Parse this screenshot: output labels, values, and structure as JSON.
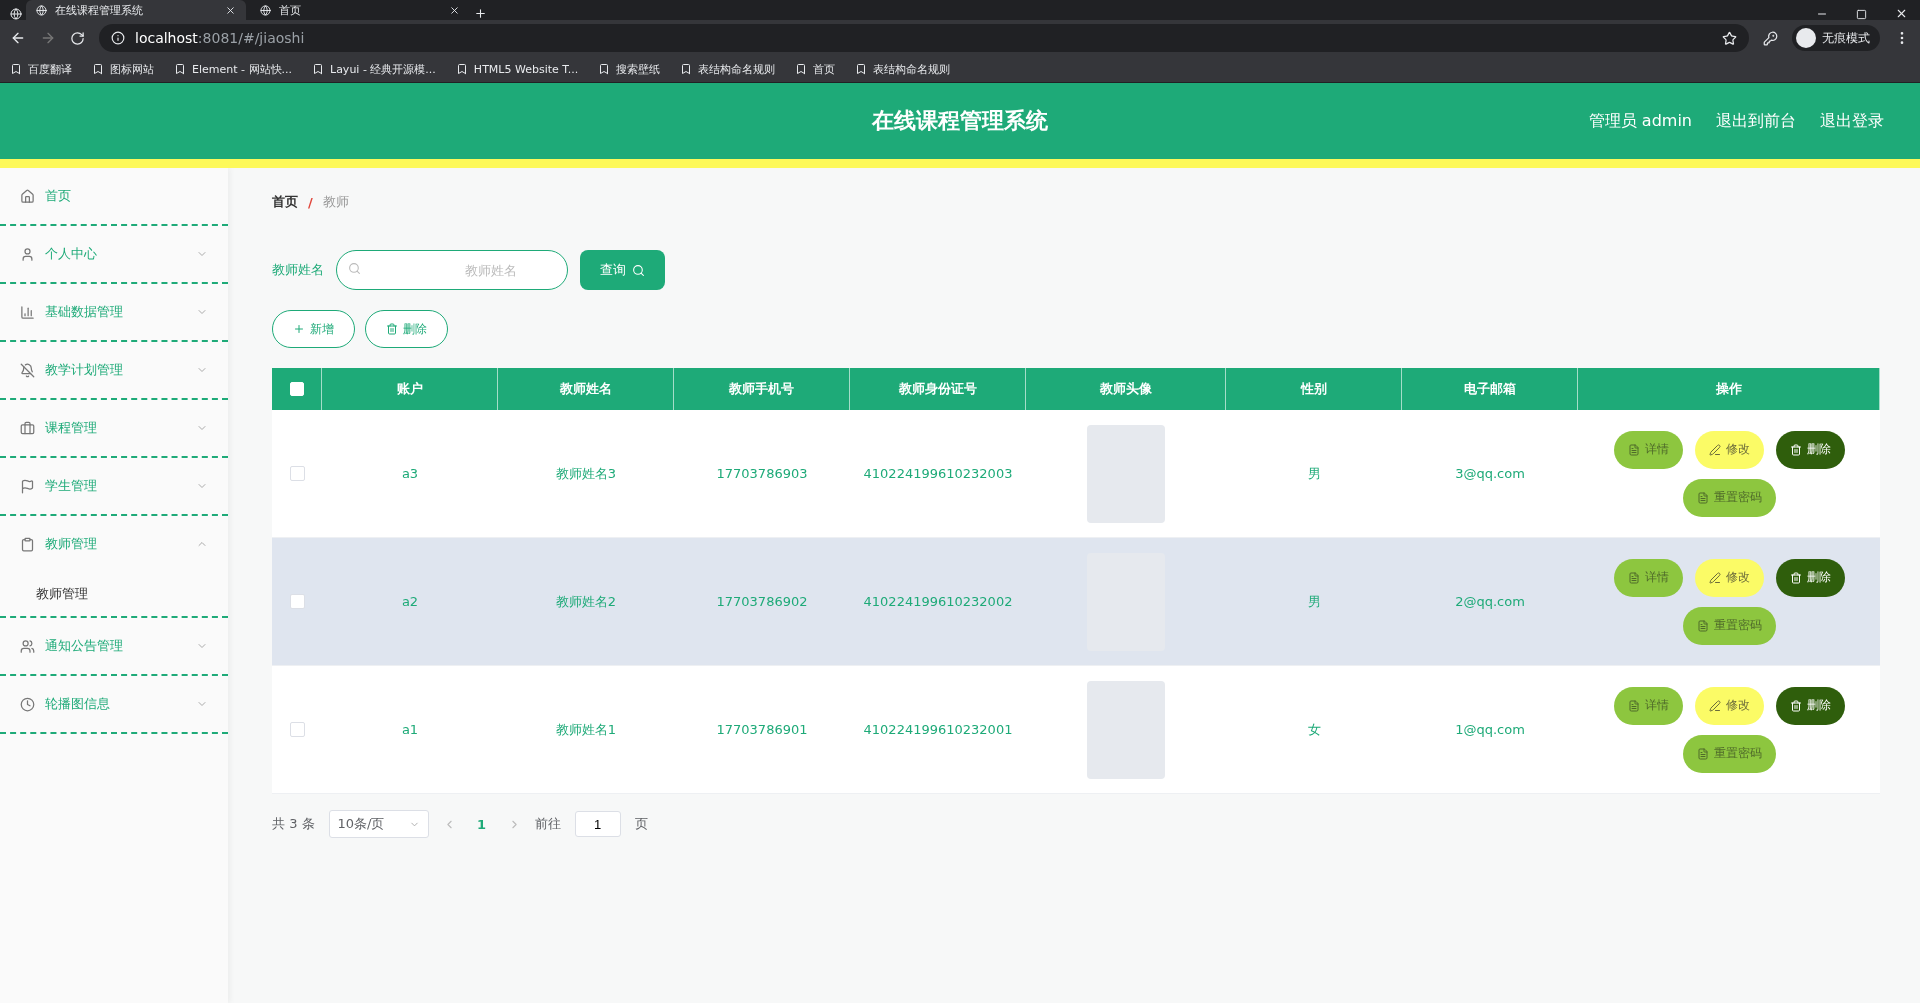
{
  "browser": {
    "tabs": [
      {
        "title": "在线课程管理系统",
        "selected": true
      },
      {
        "title": "首页",
        "selected": false
      }
    ],
    "address": {
      "host": "localhost",
      "rest": ":8081/#/jiaoshi"
    },
    "profile": "无痕模式",
    "bookmarks": [
      "百度翻译",
      "图标网站",
      "Element - 网站快...",
      "Layui - 经典开源模...",
      "HTML5 Website T...",
      "搜索壁纸",
      "表结构命名规则",
      "首页",
      "表结构命名规则"
    ]
  },
  "header": {
    "title": "在线课程管理系统",
    "links": [
      "管理员 admin",
      "退出到前台",
      "退出登录"
    ]
  },
  "sidebar": {
    "items": [
      {
        "label": "首页"
      },
      {
        "label": "个人中心",
        "expanded": false
      },
      {
        "label": "基础数据管理",
        "expanded": false
      },
      {
        "label": "教学计划管理",
        "expanded": false
      },
      {
        "label": "课程管理",
        "expanded": false
      },
      {
        "label": "学生管理",
        "expanded": false
      },
      {
        "label": "教师管理",
        "expanded": true,
        "children": [
          {
            "label": "教师管理"
          }
        ]
      },
      {
        "label": "通知公告管理",
        "expanded": false
      },
      {
        "label": "轮播图信息",
        "expanded": false
      }
    ]
  },
  "breadcrumb": {
    "items": [
      "首页",
      "教师"
    ],
    "separator": "/"
  },
  "search": {
    "label": "教师姓名",
    "placeholder": "教师姓名",
    "button": "查询"
  },
  "toolbar": [
    {
      "kind": "add",
      "label": "新增"
    },
    {
      "kind": "delete",
      "label": "删除"
    }
  ],
  "table": {
    "select_all_checked": false,
    "columns": [
      "账户",
      "教师姓名",
      "教师手机号",
      "教师身份证号",
      "教师头像",
      "性别",
      "电子邮箱",
      "操作"
    ],
    "rows": [
      {
        "checked": false,
        "highlighted": false,
        "cells": [
          "a3",
          "教师姓名3",
          "17703786903",
          "410224199610232003"
        ],
        "gender": "男",
        "email": "3@qq.com",
        "actions": [
          {
            "kind": "detail",
            "label": "详情"
          },
          {
            "kind": "edit",
            "label": "修改"
          },
          {
            "kind": "delete",
            "label": "删除"
          },
          {
            "kind": "reset",
            "label": "重置密码"
          }
        ]
      },
      {
        "checked": false,
        "highlighted": true,
        "cells": [
          "a2",
          "教师姓名2",
          "17703786902",
          "410224199610232002"
        ],
        "gender": "男",
        "email": "2@qq.com",
        "actions": [
          {
            "kind": "detail",
            "label": "详情"
          },
          {
            "kind": "edit",
            "label": "修改"
          },
          {
            "kind": "delete",
            "label": "删除"
          },
          {
            "kind": "reset",
            "label": "重置密码"
          }
        ]
      },
      {
        "checked": false,
        "highlighted": false,
        "cells": [
          "a1",
          "教师姓名1",
          "17703786901",
          "410224199610232001"
        ],
        "gender": "女",
        "email": "1@qq.com",
        "actions": [
          {
            "kind": "detail",
            "label": "详情"
          },
          {
            "kind": "edit",
            "label": "修改"
          },
          {
            "kind": "delete",
            "label": "删除"
          },
          {
            "kind": "reset",
            "label": "重置密码"
          }
        ]
      }
    ]
  },
  "pagination": {
    "total": "共 3 条",
    "page_size": "10条/页",
    "pages": [
      {
        "label": "1",
        "selected": true
      }
    ],
    "goto_label": "前往",
    "goto_value": "1",
    "goto_suffix": "页"
  }
}
